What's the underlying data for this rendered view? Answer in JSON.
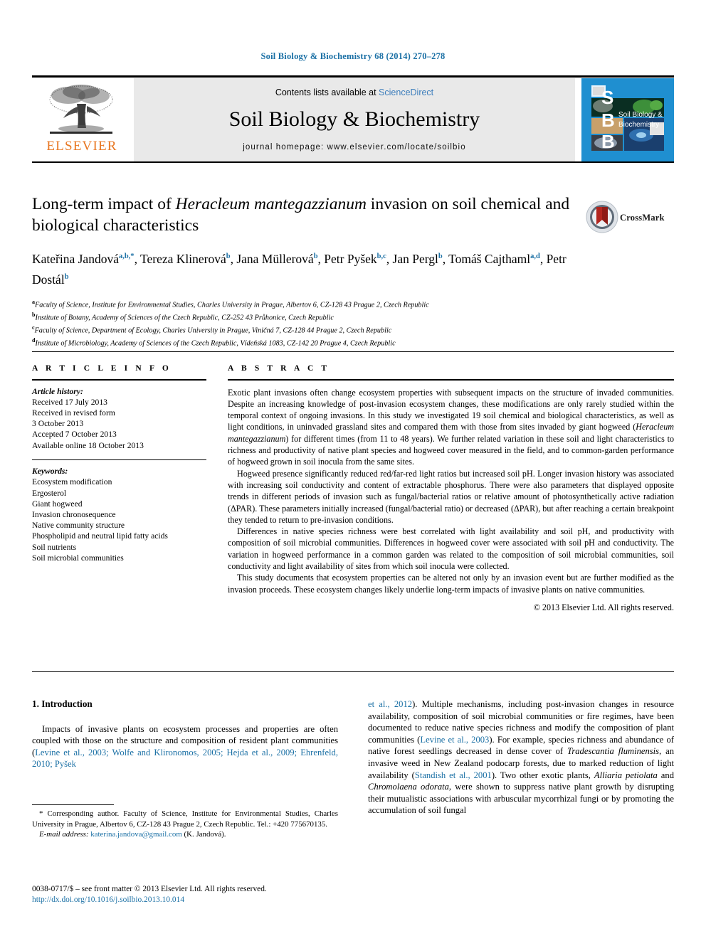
{
  "running_head": "Soil Biology & Biochemistry 68 (2014) 270–278",
  "masthead": {
    "publisher_logo_text": "ELSEVIER",
    "contents_prefix": "Contents lists available at",
    "contents_link": "ScienceDirect",
    "journal_name": "Soil Biology & Biochemistry",
    "homepage": "journal homepage: www.elsevier.com/locate/soilbio",
    "cover_letters": [
      "S",
      "B",
      "B"
    ],
    "cover_title_line1": "Soil Biology &",
    "cover_title_line2": "Biochemistry"
  },
  "article": {
    "title_part1": "Long-term impact of ",
    "title_italic": "Heracleum mantegazzianum",
    "title_part2": " invasion on soil chemical and biological characteristics",
    "crossmark_label": "CrossMark",
    "authors": [
      {
        "name": "Kateřina Jandová",
        "marks": "a,b,*"
      },
      {
        "name": "Tereza Klinerová",
        "marks": "b"
      },
      {
        "name": "Jana Müllerová",
        "marks": "b"
      },
      {
        "name": "Petr Pyšek",
        "marks": "b,c"
      },
      {
        "name": "Jan Pergl",
        "marks": "b"
      },
      {
        "name": "Tomáš Cajthaml",
        "marks": "a,d"
      },
      {
        "name": "Petr Dostál",
        "marks": "b"
      }
    ],
    "affiliations": [
      {
        "mark": "a",
        "text": "Faculty of Science, Institute for Environmental Studies, Charles University in Prague, Albertov 6, CZ-128 43 Prague 2, Czech Republic"
      },
      {
        "mark": "b",
        "text": "Institute of Botany, Academy of Sciences of the Czech Republic, CZ-252 43 Průhonice, Czech Republic"
      },
      {
        "mark": "c",
        "text": "Faculty of Science, Department of Ecology, Charles University in Prague, Viničná 7, CZ-128 44 Prague 2, Czech Republic"
      },
      {
        "mark": "d",
        "text": "Institute of Microbiology, Academy of Sciences of the Czech Republic, Vídeňská 1083, CZ-142 20 Prague 4, Czech Republic"
      }
    ]
  },
  "article_info": {
    "heading": "A R T I C L E   I N F O",
    "history_label": "Article history:",
    "history": [
      "Received 17 July 2013",
      "Received in revised form",
      "3 October 2013",
      "Accepted 7 October 2013",
      "Available online 18 October 2013"
    ],
    "keywords_label": "Keywords:",
    "keywords": [
      "Ecosystem modification",
      "Ergosterol",
      "Giant hogweed",
      "Invasion chronosequence",
      "Native community structure",
      "Phospholipid and neutral lipid fatty acids",
      "Soil nutrients",
      "Soil microbial communities"
    ]
  },
  "abstract": {
    "heading": "A B S T R A C T",
    "para1_a": "Exotic plant invasions often change ecosystem properties with subsequent impacts on the structure of invaded communities. Despite an increasing knowledge of post-invasion ecosystem changes, these modifications are only rarely studied within the temporal context of ongoing invasions. In this study we investigated 19 soil chemical and biological characteristics, as well as light conditions, in uninvaded grassland sites and compared them with those from sites invaded by giant hogweed (",
    "para1_italic": "Heracleum mantegazzianum",
    "para1_b": ") for different times (from 11 to 48 years). We further related variation in these soil and light characteristics to richness and productivity of native plant species and hogweed cover measured in the field, and to common-garden performance of hogweed grown in soil inocula from the same sites.",
    "para2": "Hogweed presence significantly reduced red/far-red light ratios but increased soil pH. Longer invasion history was associated with increasing soil conductivity and content of extractable phosphorus. There were also parameters that displayed opposite trends in different periods of invasion such as fungal/bacterial ratios or relative amount of photosynthetically active radiation (ΔPAR). These parameters initially increased (fungal/bacterial ratio) or decreased (ΔPAR), but after reaching a certain breakpoint they tended to return to pre-invasion conditions.",
    "para3": "Differences in native species richness were best correlated with light availability and soil pH, and productivity with composition of soil microbial communities. Differences in hogweed cover were associated with soil pH and conductivity. The variation in hogweed performance in a common garden was related to the composition of soil microbial communities, soil conductivity and light availability of sites from which soil inocula were collected.",
    "para4": "This study documents that ecosystem properties can be altered not only by an invasion event but are further modified as the invasion proceeds. These ecosystem changes likely underlie long-term impacts of invasive plants on native communities.",
    "copyright": "© 2013 Elsevier Ltd. All rights reserved."
  },
  "introduction": {
    "heading": "1. Introduction",
    "left_p1_a": "Impacts of invasive plants on ecosystem processes and properties are often coupled with those on the structure and composition of resident plant communities (",
    "left_p1_refs": "Levine et al., 2003; Wolfe and Klironomos, 2005; Hejda et al., 2009; Ehrenfeld, 2010; Pyšek",
    "right_ref1": "et al., 2012",
    "right_a": "). Multiple mechanisms, including post-invasion changes in resource availability, composition of soil microbial communities or fire regimes, have been documented to reduce native species richness and modify the composition of plant communities (",
    "right_ref2": "Levine et al., 2003",
    "right_b": "). For example, species richness and abundance of native forest seedlings decreased in dense cover of ",
    "right_italic1": "Tradescantia fluminensis",
    "right_c": ", an invasive weed in New Zealand podocarp forests, due to marked reduction of light availability (",
    "right_ref3": "Standish et al., 2001",
    "right_d": "). Two other exotic plants, ",
    "right_italic2": "Alliaria petiolata",
    "right_e": " and ",
    "right_italic3": "Chromolaena odorata",
    "right_f": ", were shown to suppress native plant growth by disrupting their mutualistic associations with arbuscular mycorrhizal fungi or by promoting the accumulation of soil fungal"
  },
  "footnote": {
    "corresponding": "* Corresponding author. Faculty of Science, Institute for Environmental Studies, Charles University in Prague, Albertov 6, CZ-128 43 Prague 2, Czech Republic. Tel.: +420 775670135.",
    "email_label": "E-mail address:",
    "email": "katerina.jandova@gmail.com",
    "email_suffix": "(K. Jandová)."
  },
  "issn": {
    "line1": "0038-0717/$ – see front matter © 2013 Elsevier Ltd. All rights reserved.",
    "doi": "http://dx.doi.org/10.1016/j.soilbio.2013.10.014"
  },
  "colors": {
    "accent_blue": "#1b70a5",
    "link_blue": "#3d7ebc",
    "elsevier_orange": "#e87722",
    "cover_blue": "#1f8fd0",
    "masthead_grey": "#e9e9e9"
  }
}
